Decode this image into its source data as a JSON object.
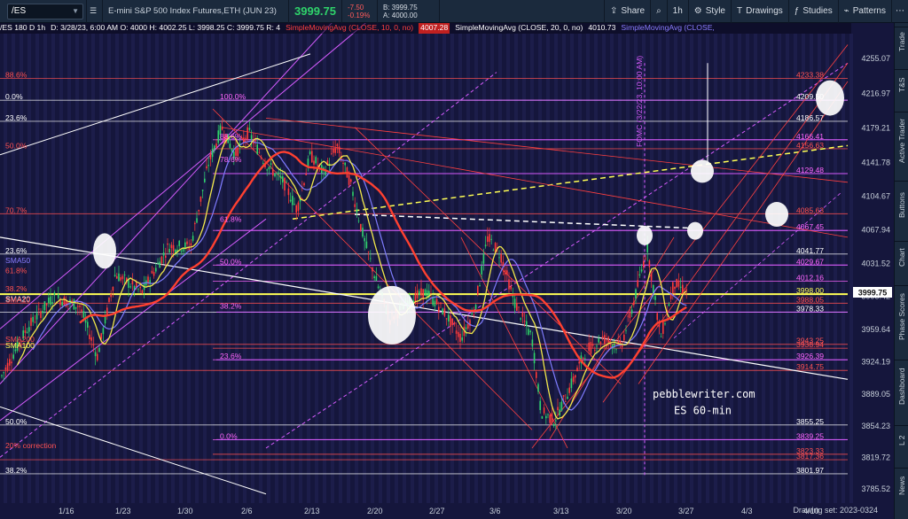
{
  "toolbar": {
    "symbol": "/ES",
    "description": "E-mini S&P 500 Index Futures,ETH (JUN 23)",
    "last_price": "3999.75",
    "net_change": "-7.50",
    "pct_change": "-0.19%",
    "bid": "B: 3999.75",
    "ask": "A: 4000.00",
    "share": "Share",
    "interval": "1h",
    "style": "Style",
    "drawings": "Drawings",
    "studies": "Studies",
    "patterns": "Patterns"
  },
  "chart_header": {
    "symbol_period": "/ES 180 D 1h",
    "ohlc": "D: 3/28/23, 6:00 AM  O: 4000  H: 4002.25  L: 3998.25  C: 3999.75  R: 4",
    "sma10_label": "SimpleMovingAvg (CLOSE, 10, 0, no)",
    "sma10_value": "4007.28",
    "sma20_label": "SimpleMovingAvg (CLOSE, 20, 0, no)",
    "sma20_value": "4010.73",
    "sma50_label": "SimpleMovingAvg (CLOSE,"
  },
  "price_axis": [
    "4255.07",
    "4216.97",
    "4179.21",
    "4141.78",
    "4104.67",
    "4067.94",
    "4031.52",
    "3995.42",
    "3959.64",
    "3924.19",
    "3889.05",
    "3854.23",
    "3819.72",
    "3785.52"
  ],
  "current_price_tag": "3999.75",
  "right_levels": [
    {
      "label": "4233.38",
      "color": "#ff5050"
    },
    {
      "label": "4209.50",
      "color": "#ffffff"
    },
    {
      "label": "4186.57",
      "color": "#ffffff"
    },
    {
      "label": "4166.41",
      "color": "#ff66ff"
    },
    {
      "label": "4156.63",
      "color": "#ff5050"
    },
    {
      "label": "4129.48",
      "color": "#ff66ff"
    },
    {
      "label": "4085.63",
      "color": "#ff5050"
    },
    {
      "label": "4067.45",
      "color": "#ff66ff"
    },
    {
      "label": "4041.77",
      "color": "#ffffff"
    },
    {
      "label": "4029.67",
      "color": "#ff66ff"
    },
    {
      "label": "4012.16",
      "color": "#ff66ff"
    },
    {
      "label": "3998.00",
      "color": "#ffff55"
    },
    {
      "label": "3988.05",
      "color": "#ff5050"
    },
    {
      "label": "3978.33",
      "color": "#ffffff"
    },
    {
      "label": "3943.25",
      "color": "#ff5050"
    },
    {
      "label": "3938.94",
      "color": "#ff5050"
    },
    {
      "label": "3926.39",
      "color": "#ff66ff"
    },
    {
      "label": "3914.75",
      "color": "#ff5050"
    },
    {
      "label": "3855.25",
      "color": "#ffffff"
    },
    {
      "label": "3839.25",
      "color": "#ff66ff"
    },
    {
      "label": "3823.33",
      "color": "#ff5050"
    },
    {
      "label": "3817.36",
      "color": "#ff5050"
    },
    {
      "label": "3801.97",
      "color": "#ffffff"
    }
  ],
  "left_labels": [
    {
      "label": "88.6%",
      "color": "#ff5050"
    },
    {
      "label": "0.0%",
      "color": "#ffffff"
    },
    {
      "label": "23.6%",
      "color": "#ffffff"
    },
    {
      "label": "50.0%",
      "color": "#ff5050"
    },
    {
      "label": "70.7%",
      "color": "#ff5050"
    },
    {
      "label": "23.6%",
      "color": "#ffffff"
    },
    {
      "label": "SMA50",
      "color": "#8a7cff"
    },
    {
      "label": "61.8%",
      "color": "#ff5050"
    },
    {
      "label": "38.2%",
      "color": "#ff5050"
    },
    {
      "label": "SMA20",
      "color": "#ffffff"
    },
    {
      "label": "SMA10",
      "color": "#ff5050"
    },
    {
      "label": "SMA200",
      "color": "#ff5050"
    },
    {
      "label": "SMA100",
      "color": "#ffff55"
    },
    {
      "label": "50.0%",
      "color": "#ffffff"
    },
    {
      "label": "38.2%",
      "color": "#ffffff"
    },
    {
      "label": "20% correction",
      "color": "#ff5050"
    }
  ],
  "fib_labels": [
    {
      "label": "100.0%"
    },
    {
      "label": "88.6%"
    },
    {
      "label": "78.6%"
    },
    {
      "label": "61.8%"
    },
    {
      "label": "50.0%"
    },
    {
      "label": "38.2%"
    },
    {
      "label": "23.6%"
    },
    {
      "label": "0.0%"
    }
  ],
  "annotations": {
    "fomc": "FOMC (3/22/23, 10:00 AM)",
    "watermark_line1": "pebblewriter.com",
    "watermark_line2": "ES 60-min"
  },
  "x_axis": [
    "1/16",
    "1/23",
    "1/30",
    "2/6",
    "2/13",
    "2/20",
    "2/27",
    "3/6",
    "3/13",
    "3/20",
    "3/27",
    "4/3",
    "4/10"
  ],
  "footer": {
    "drawing_set": "Drawing set: 2023-0324"
  },
  "side_tabs": [
    "Trade",
    "T&S",
    "Active Trader",
    "Buttons",
    "Chart",
    "Phase Scores",
    "Dashboard",
    "L 2",
    "News"
  ],
  "colors": {
    "background": "#15163c",
    "price_up": "#2fd36b",
    "sma10": "#ff4030",
    "sma20": "#f2e84a",
    "sma50": "#7f7cff",
    "fib": "#d65cff"
  }
}
